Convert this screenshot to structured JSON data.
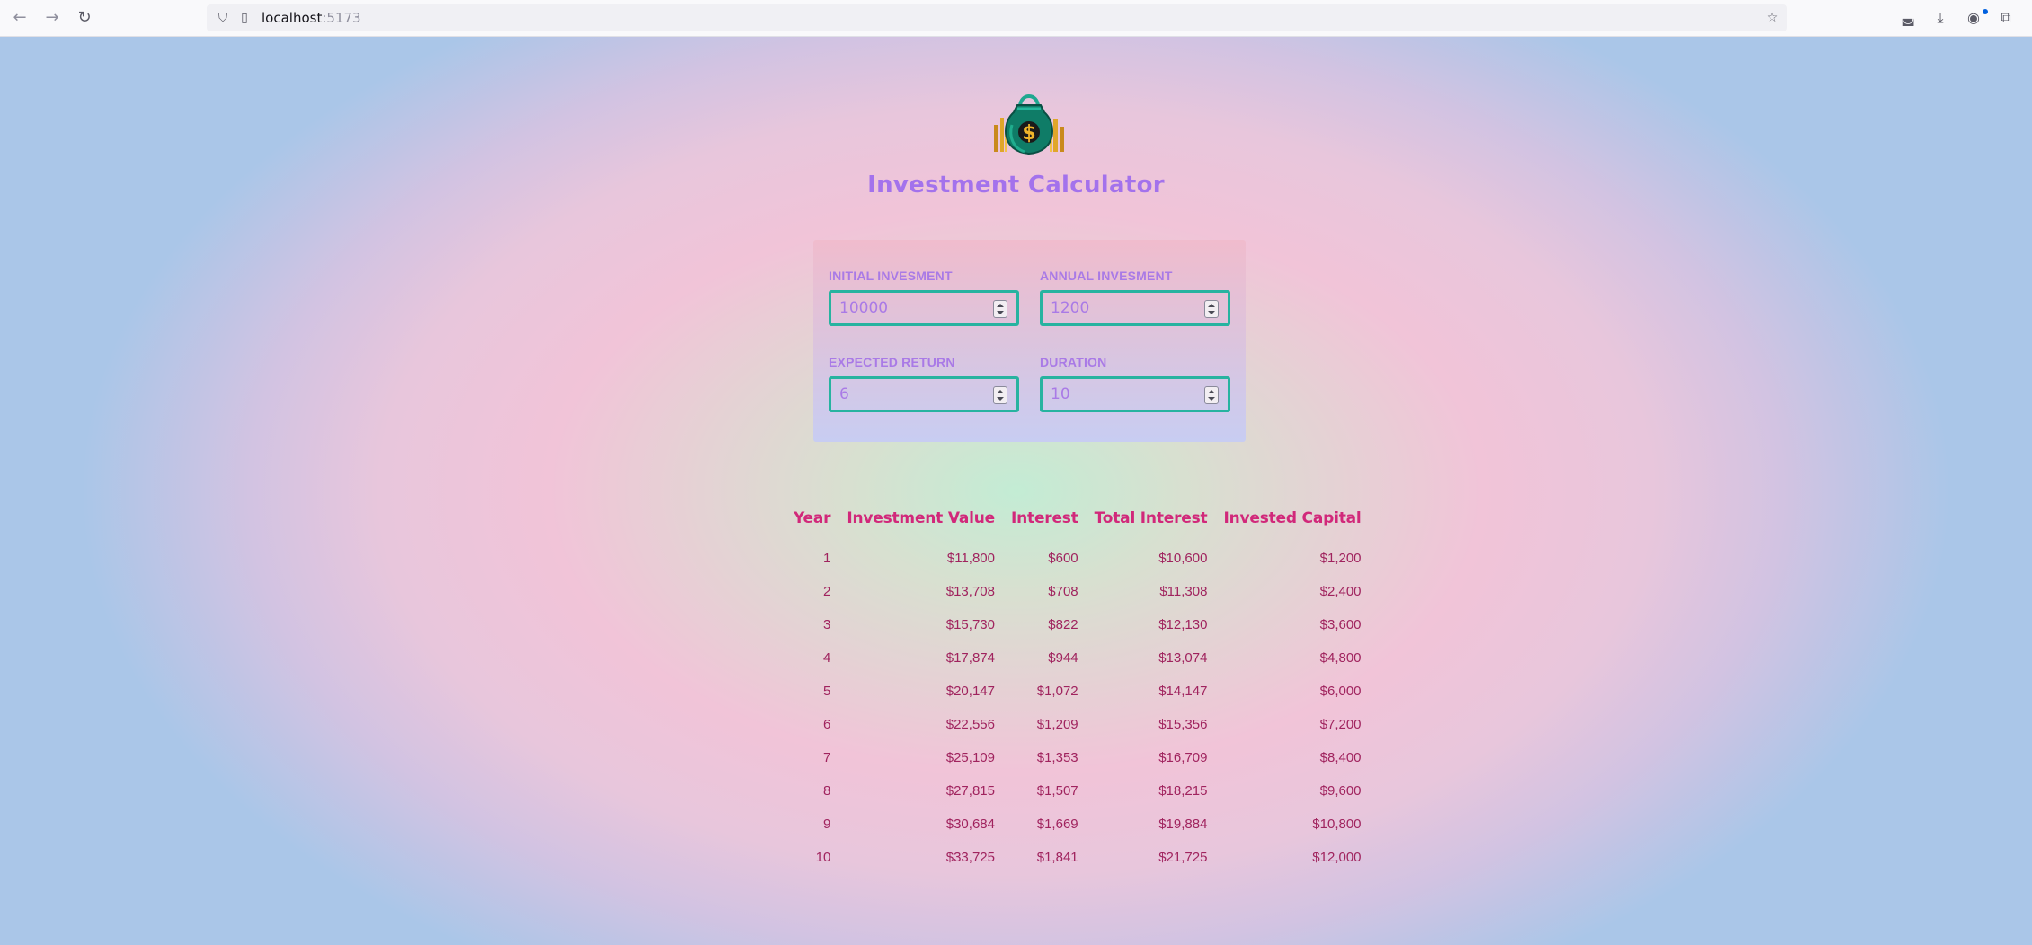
{
  "browser": {
    "url_host": "localhost",
    "url_port": ":5173",
    "icons": [
      "back-icon",
      "forward-icon",
      "reload-icon",
      "shield-icon",
      "page-icon",
      "bookmark-star-icon",
      "pocket-icon",
      "download-icon",
      "account-icon",
      "extensions-icon"
    ]
  },
  "app": {
    "title": "Investment Calculator"
  },
  "inputs": {
    "initial_investment": {
      "label": "INITIAL INVESMENT",
      "value": "10000"
    },
    "annual_investment": {
      "label": "ANNUAL INVESMENT",
      "value": "1200"
    },
    "expected_return": {
      "label": "EXPECTED RETURN",
      "value": "6"
    },
    "duration": {
      "label": "DURATION",
      "value": "10"
    }
  },
  "results": {
    "headers": [
      "Year",
      "Investment Value",
      "Interest",
      "Total Interest",
      "Invested Capital"
    ],
    "rows": [
      [
        "1",
        "$11,800",
        "$600",
        "$10,600",
        "$1,200"
      ],
      [
        "2",
        "$13,708",
        "$708",
        "$11,308",
        "$2,400"
      ],
      [
        "3",
        "$15,730",
        "$822",
        "$12,130",
        "$3,600"
      ],
      [
        "4",
        "$17,874",
        "$944",
        "$13,074",
        "$4,800"
      ],
      [
        "5",
        "$20,147",
        "$1,072",
        "$14,147",
        "$6,000"
      ],
      [
        "6",
        "$22,556",
        "$1,209",
        "$15,356",
        "$7,200"
      ],
      [
        "7",
        "$25,109",
        "$1,353",
        "$16,709",
        "$8,400"
      ],
      [
        "8",
        "$27,815",
        "$1,507",
        "$18,215",
        "$9,600"
      ],
      [
        "9",
        "$30,684",
        "$1,669",
        "$19,884",
        "$10,800"
      ],
      [
        "10",
        "$33,725",
        "$1,841",
        "$21,725",
        "$12,000"
      ]
    ]
  },
  "colors": {
    "title": "#a372ec",
    "label": "#a97ae6",
    "input_border": "#27b3a0",
    "table_header": "#d1287a",
    "table_cell": "#a0235e"
  }
}
